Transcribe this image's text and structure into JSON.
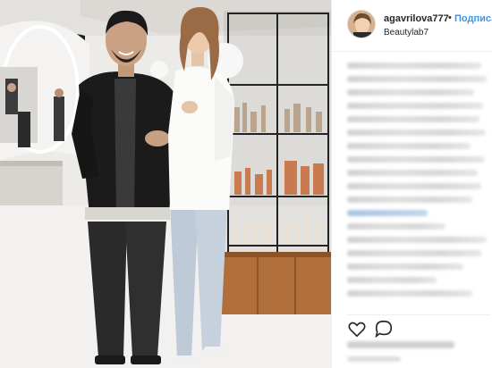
{
  "post": {
    "username": "agavrilova777",
    "separator": "•",
    "follow_label": "Подписа",
    "location": "Beautylab7"
  },
  "photo": {
    "description_icon": "photo",
    "accent_colors": {
      "link": "#3897f0",
      "username": "#262626"
    }
  },
  "actions": {
    "like_icon": "heart-icon",
    "comment_icon": "comment-icon"
  }
}
